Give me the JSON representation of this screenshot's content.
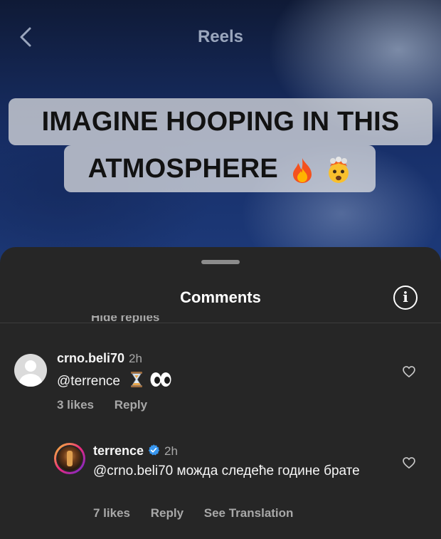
{
  "topbar": {
    "title": "Reels"
  },
  "caption": {
    "line1": "IMAGINE HOOPING IN THIS",
    "line2": "ATMOSPHERE"
  },
  "sheet": {
    "title": "Comments",
    "hidden_replies": "Hide replies"
  },
  "comments": [
    {
      "username": "crno.beli70",
      "time": "2h",
      "text": "@terrence",
      "likes": "3 likes",
      "reply": "Reply"
    },
    {
      "username": "terrence",
      "verified": true,
      "time": "2h",
      "text": "@crno.beli70 можда следеће године брате",
      "likes": "7 likes",
      "reply": "Reply",
      "translate": "See Translation"
    }
  ],
  "icons": {
    "back": "chevron-left-icon",
    "info": "info-icon",
    "like": "heart-icon",
    "verified": "verified-badge-icon"
  },
  "colors": {
    "sheet_bg": "#262626",
    "verified": "#3897f0",
    "text_secondary": "#a8a8a8"
  }
}
